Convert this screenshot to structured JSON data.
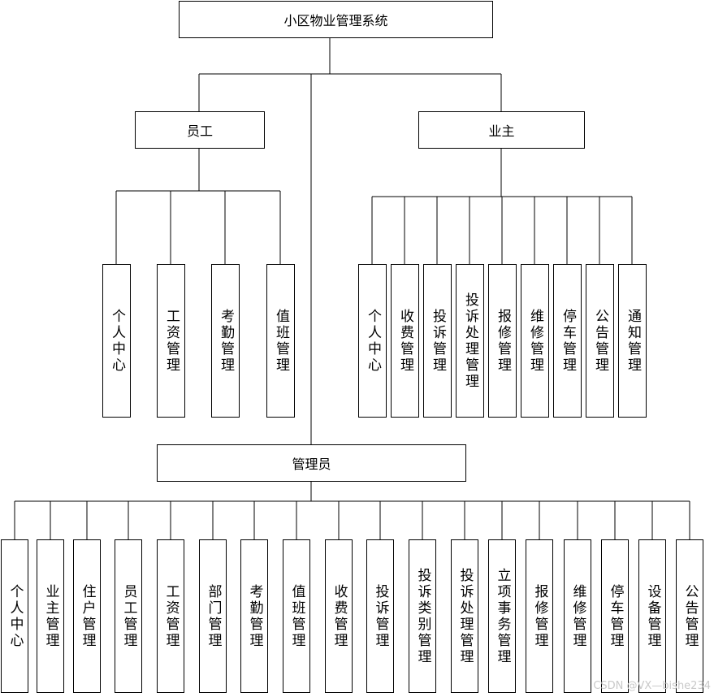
{
  "root": "小区物业管理系统",
  "employee": {
    "label": "员工",
    "items": [
      "个人中心",
      "工资管理",
      "考勤管理",
      "值班管理"
    ]
  },
  "owner": {
    "label": "业主",
    "items": [
      "个人中心",
      "收费管理",
      "投诉管理",
      "投诉处理管理",
      "报修管理",
      "维修管理",
      "停车管理",
      "公告管理",
      "通知管理"
    ]
  },
  "admin": {
    "label": "管理员",
    "items": [
      "个人中心",
      "业主管理",
      "住户管理",
      "员工管理",
      "工资管理",
      "部门管理",
      "考勤管理",
      "值班管理",
      "收费管理",
      "投诉管理",
      "投诉类别管理",
      "投诉处理管理",
      "立项事务管理",
      "报修管理",
      "维修管理",
      "停车管理",
      "设备管理",
      "公告管理"
    ]
  },
  "watermark": "CSDN @VX—bishe234"
}
